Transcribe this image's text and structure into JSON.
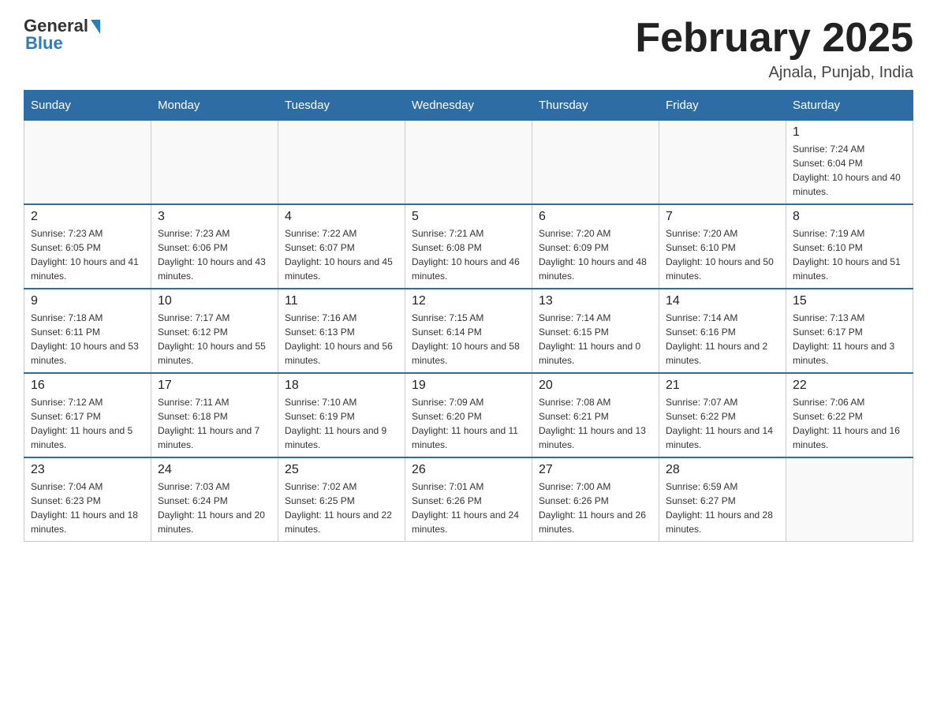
{
  "header": {
    "logo_general": "General",
    "logo_blue": "Blue",
    "month_title": "February 2025",
    "subtitle": "Ajnala, Punjab, India"
  },
  "weekdays": [
    "Sunday",
    "Monday",
    "Tuesday",
    "Wednesday",
    "Thursday",
    "Friday",
    "Saturday"
  ],
  "weeks": [
    [
      {
        "day": "",
        "info": ""
      },
      {
        "day": "",
        "info": ""
      },
      {
        "day": "",
        "info": ""
      },
      {
        "day": "",
        "info": ""
      },
      {
        "day": "",
        "info": ""
      },
      {
        "day": "",
        "info": ""
      },
      {
        "day": "1",
        "info": "Sunrise: 7:24 AM\nSunset: 6:04 PM\nDaylight: 10 hours and 40 minutes."
      }
    ],
    [
      {
        "day": "2",
        "info": "Sunrise: 7:23 AM\nSunset: 6:05 PM\nDaylight: 10 hours and 41 minutes."
      },
      {
        "day": "3",
        "info": "Sunrise: 7:23 AM\nSunset: 6:06 PM\nDaylight: 10 hours and 43 minutes."
      },
      {
        "day": "4",
        "info": "Sunrise: 7:22 AM\nSunset: 6:07 PM\nDaylight: 10 hours and 45 minutes."
      },
      {
        "day": "5",
        "info": "Sunrise: 7:21 AM\nSunset: 6:08 PM\nDaylight: 10 hours and 46 minutes."
      },
      {
        "day": "6",
        "info": "Sunrise: 7:20 AM\nSunset: 6:09 PM\nDaylight: 10 hours and 48 minutes."
      },
      {
        "day": "7",
        "info": "Sunrise: 7:20 AM\nSunset: 6:10 PM\nDaylight: 10 hours and 50 minutes."
      },
      {
        "day": "8",
        "info": "Sunrise: 7:19 AM\nSunset: 6:10 PM\nDaylight: 10 hours and 51 minutes."
      }
    ],
    [
      {
        "day": "9",
        "info": "Sunrise: 7:18 AM\nSunset: 6:11 PM\nDaylight: 10 hours and 53 minutes."
      },
      {
        "day": "10",
        "info": "Sunrise: 7:17 AM\nSunset: 6:12 PM\nDaylight: 10 hours and 55 minutes."
      },
      {
        "day": "11",
        "info": "Sunrise: 7:16 AM\nSunset: 6:13 PM\nDaylight: 10 hours and 56 minutes."
      },
      {
        "day": "12",
        "info": "Sunrise: 7:15 AM\nSunset: 6:14 PM\nDaylight: 10 hours and 58 minutes."
      },
      {
        "day": "13",
        "info": "Sunrise: 7:14 AM\nSunset: 6:15 PM\nDaylight: 11 hours and 0 minutes."
      },
      {
        "day": "14",
        "info": "Sunrise: 7:14 AM\nSunset: 6:16 PM\nDaylight: 11 hours and 2 minutes."
      },
      {
        "day": "15",
        "info": "Sunrise: 7:13 AM\nSunset: 6:17 PM\nDaylight: 11 hours and 3 minutes."
      }
    ],
    [
      {
        "day": "16",
        "info": "Sunrise: 7:12 AM\nSunset: 6:17 PM\nDaylight: 11 hours and 5 minutes."
      },
      {
        "day": "17",
        "info": "Sunrise: 7:11 AM\nSunset: 6:18 PM\nDaylight: 11 hours and 7 minutes."
      },
      {
        "day": "18",
        "info": "Sunrise: 7:10 AM\nSunset: 6:19 PM\nDaylight: 11 hours and 9 minutes."
      },
      {
        "day": "19",
        "info": "Sunrise: 7:09 AM\nSunset: 6:20 PM\nDaylight: 11 hours and 11 minutes."
      },
      {
        "day": "20",
        "info": "Sunrise: 7:08 AM\nSunset: 6:21 PM\nDaylight: 11 hours and 13 minutes."
      },
      {
        "day": "21",
        "info": "Sunrise: 7:07 AM\nSunset: 6:22 PM\nDaylight: 11 hours and 14 minutes."
      },
      {
        "day": "22",
        "info": "Sunrise: 7:06 AM\nSunset: 6:22 PM\nDaylight: 11 hours and 16 minutes."
      }
    ],
    [
      {
        "day": "23",
        "info": "Sunrise: 7:04 AM\nSunset: 6:23 PM\nDaylight: 11 hours and 18 minutes."
      },
      {
        "day": "24",
        "info": "Sunrise: 7:03 AM\nSunset: 6:24 PM\nDaylight: 11 hours and 20 minutes."
      },
      {
        "day": "25",
        "info": "Sunrise: 7:02 AM\nSunset: 6:25 PM\nDaylight: 11 hours and 22 minutes."
      },
      {
        "day": "26",
        "info": "Sunrise: 7:01 AM\nSunset: 6:26 PM\nDaylight: 11 hours and 24 minutes."
      },
      {
        "day": "27",
        "info": "Sunrise: 7:00 AM\nSunset: 6:26 PM\nDaylight: 11 hours and 26 minutes."
      },
      {
        "day": "28",
        "info": "Sunrise: 6:59 AM\nSunset: 6:27 PM\nDaylight: 11 hours and 28 minutes."
      },
      {
        "day": "",
        "info": ""
      }
    ]
  ]
}
